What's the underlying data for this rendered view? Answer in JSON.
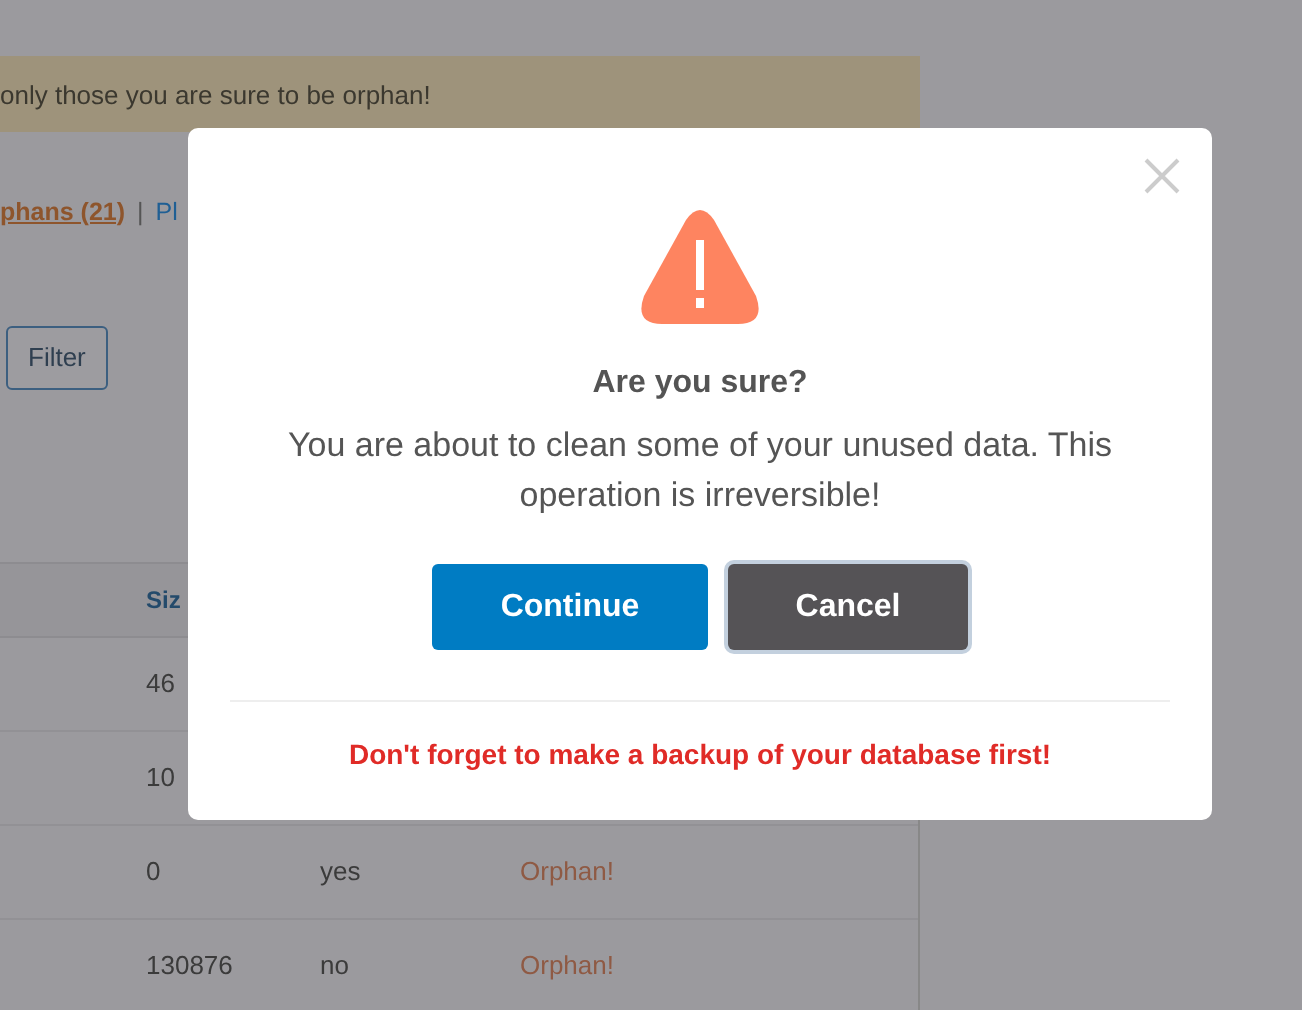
{
  "background_page": {
    "notice": "only those you are sure to be orphan!",
    "filter_links": [
      {
        "label": "phans (21)",
        "selected": true
      },
      {
        "label": "Pl",
        "selected": false
      }
    ],
    "separator": "|",
    "filter_button": "Filter",
    "table": {
      "columns": [
        "Siz"
      ],
      "rows": [
        {
          "cells": [
            "46"
          ]
        },
        {
          "cells": [
            "10"
          ]
        },
        {
          "cells": [
            "0",
            "yes",
            "Orphan!"
          ]
        },
        {
          "cells": [
            "130876",
            "no",
            "Orphan!"
          ]
        }
      ]
    }
  },
  "dialog": {
    "title": "Are you sure?",
    "message": "You are about to clean some of your unused data. This operation is irreversible!",
    "buttons": [
      {
        "label": "Continue",
        "kind": "primary"
      },
      {
        "label": "Cancel",
        "kind": "secondary"
      }
    ],
    "footer": "Don't forget to make a backup of your database first!"
  }
}
